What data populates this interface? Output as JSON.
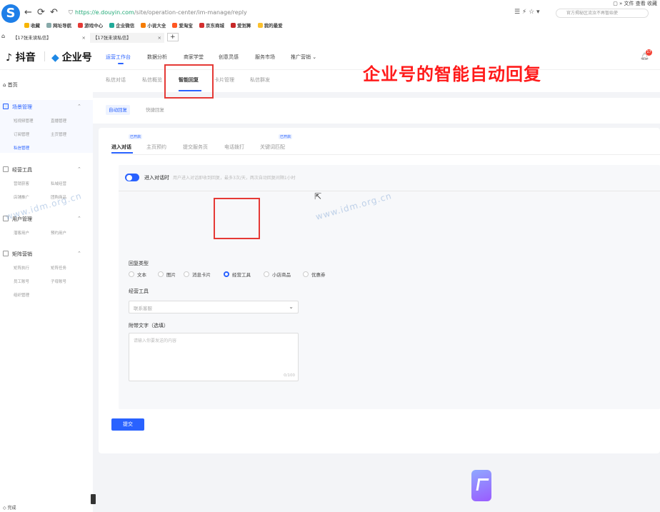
{
  "browser": {
    "url_host": "https://e.douyin.com",
    "url_path": "/site/operation-center/im-manage/reply",
    "search_placeholder": "官方揭秘区流汝不再暂始使",
    "top_menu": "▢ » 文件 查看 收藏",
    "bookmarks": [
      "收藏",
      "网址导航",
      "游戏中心",
      "企业微信",
      "小说大全",
      "爱淘宝",
      "京东商城",
      "爱划算",
      "我的最爱"
    ],
    "tabs": [
      "【17张未读私信】",
      "【17张未读私信】"
    ],
    "new_tab": "+",
    "status": "完成"
  },
  "header": {
    "douyin_logo": "抖音",
    "qiye_logo": "企业号",
    "nav": [
      "运营工作台",
      "数据分析",
      "商家学堂",
      "创意灵感",
      "服务市场",
      "推广营销"
    ],
    "bell_count": "17"
  },
  "sidebar": {
    "home": "首页",
    "groups": [
      {
        "title": "场景管理",
        "items": [
          "短视频管理",
          "直播管理",
          "订阅管理",
          "主页管理",
          "私信管理"
        ]
      },
      {
        "title": "经营工具",
        "items": [
          "营销获客",
          "私域经营",
          "店铺推广",
          "团购商品"
        ]
      },
      {
        "title": "用户管理",
        "items": [
          "潜客用户",
          "预约用户"
        ]
      },
      {
        "title": "矩阵营销",
        "items": [
          "矩阵执行",
          "矩阵任务",
          "员工账号",
          "子母账号",
          "组织管理"
        ]
      }
    ]
  },
  "subtabs": [
    "私信对话",
    "私信概览",
    "智能回复",
    "卡片管理",
    "私信群发"
  ],
  "reply_modes": [
    "自动回复",
    "快捷回复"
  ],
  "card_tabs": [
    {
      "label": "进入对话",
      "badge": "已开启"
    },
    {
      "label": "主页预约",
      "badge": ""
    },
    {
      "label": "提交服务页",
      "badge": ""
    },
    {
      "label": "电话拨打",
      "badge": ""
    },
    {
      "label": "关键词匹配",
      "badge": "已开启"
    }
  ],
  "form": {
    "toggle_label": "进入对话时",
    "toggle_desc": "用户进入对话即收到回复，最多3次/天，两次自动回复间隔1小时",
    "reply_type_label": "回复类型",
    "reply_types": [
      "文本",
      "图片",
      "消息卡片",
      "经营工具",
      "小店商品",
      "优惠券"
    ],
    "selected_type": "经营工具",
    "tool_label": "经营工具",
    "tool_placeholder": "联系客服",
    "attach_label": "附带文字（选填）",
    "attach_placeholder": "请输入你要发送的内容",
    "attach_count": "0/100",
    "submit_label": "提交"
  },
  "annotation": {
    "title": "企业号的智能自动回复",
    "watermark": "www.idm.org.cn"
  },
  "colors": {
    "accent": "#2962ff",
    "annotation": "#ff1a1a"
  }
}
